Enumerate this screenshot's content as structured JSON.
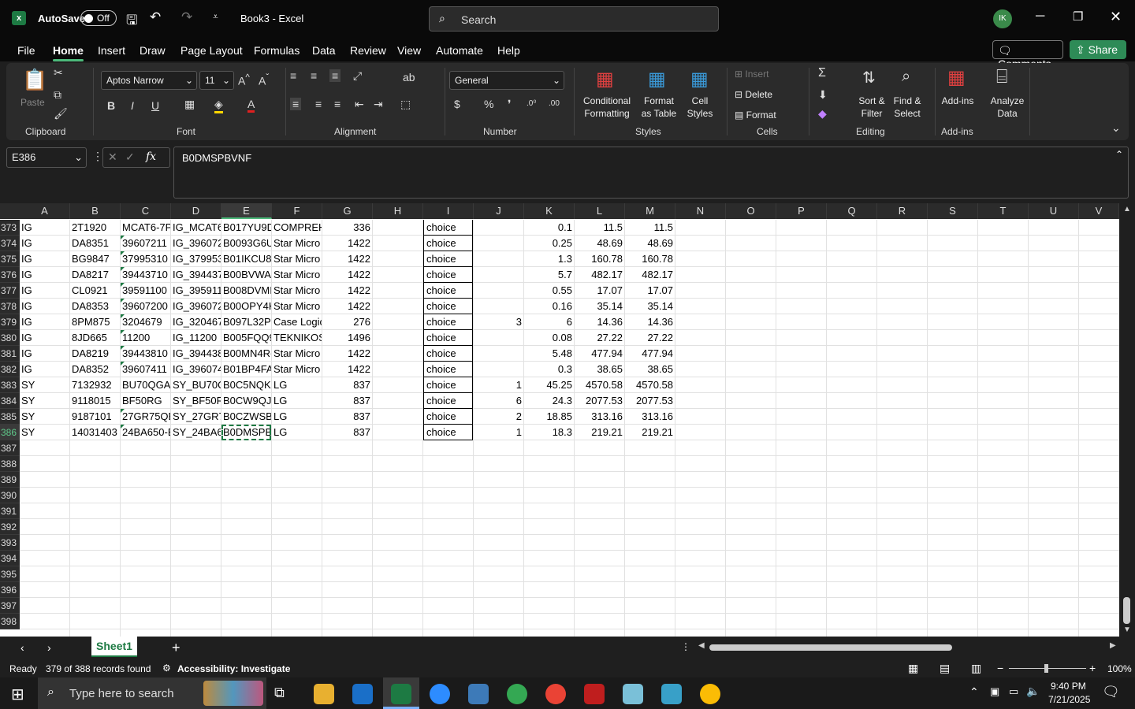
{
  "title_bar": {
    "autosave_label": "AutoSave",
    "autosave_state": "Off",
    "doc_title": "Book3 - Excel",
    "search_placeholder": "Search",
    "avatar_initials": "IK"
  },
  "menu": {
    "items": [
      "File",
      "Home",
      "Insert",
      "Draw",
      "Page Layout",
      "Formulas",
      "Data",
      "Review",
      "View",
      "Automate",
      "Help"
    ],
    "comments": "Comments",
    "share": "Share"
  },
  "ribbon": {
    "clipboard": {
      "paste": "Paste",
      "label": "Clipboard"
    },
    "font": {
      "name": "Aptos Narrow",
      "size": "11",
      "label": "Font"
    },
    "alignment": {
      "label": "Alignment"
    },
    "number": {
      "format": "General",
      "label": "Number"
    },
    "styles": {
      "conditional": "Conditional Formatting",
      "format_table": "Format as Table",
      "cell_styles": "Cell Styles",
      "label": "Styles"
    },
    "cells": {
      "insert": "Insert",
      "delete": "Delete",
      "format": "Format",
      "label": "Cells"
    },
    "editing": {
      "sort": "Sort & Filter",
      "find": "Find & Select",
      "label": "Editing"
    },
    "addins": {
      "addins": "Add-ins",
      "analyze": "Analyze Data",
      "label": "Add-ins"
    }
  },
  "formula_bar": {
    "name_box": "E386",
    "fx": "fx",
    "value": "B0DMSPBVNF"
  },
  "columns": [
    "A",
    "B",
    "C",
    "D",
    "E",
    "F",
    "G",
    "H",
    "I",
    "J",
    "K",
    "L",
    "M",
    "N",
    "O",
    "P",
    "Q",
    "R",
    "S",
    "T",
    "U",
    "V"
  ],
  "rows": [
    {
      "n": "373",
      "A": "IG",
      "B": "2T1920",
      "C": "MCAT6-7P",
      "D": "IG_MCAT6",
      "E": "B017YU9D",
      "F": "COMPREH",
      "G": "336",
      "I": "choice",
      "J": "",
      "K": "0.1",
      "L": "11.5",
      "M": "11.5"
    },
    {
      "n": "374",
      "A": "IG",
      "B": "DA8351",
      "C": "39607211",
      "D": "IG_396072",
      "E": "B0093G6U",
      "F": "Star Micro",
      "G": "1422",
      "I": "choice",
      "J": "",
      "K": "0.25",
      "L": "48.69",
      "M": "48.69"
    },
    {
      "n": "375",
      "A": "IG",
      "B": "BG9847",
      "C": "37995310",
      "D": "IG_379953",
      "E": "B01IKCU8/",
      "F": "Star Micro",
      "G": "1422",
      "I": "choice",
      "J": "",
      "K": "1.3",
      "L": "160.78",
      "M": "160.78"
    },
    {
      "n": "376",
      "A": "IG",
      "B": "DA8217",
      "C": "39443710",
      "D": "IG_394437",
      "E": "B00BVWA(",
      "F": "Star Micro",
      "G": "1422",
      "I": "choice",
      "J": "",
      "K": "5.7",
      "L": "482.17",
      "M": "482.17"
    },
    {
      "n": "377",
      "A": "IG",
      "B": "CL0921",
      "C": "39591100",
      "D": "IG_395911",
      "E": "B008DVMI",
      "F": "Star Micro",
      "G": "1422",
      "I": "choice",
      "J": "",
      "K": "0.55",
      "L": "17.07",
      "M": "17.07"
    },
    {
      "n": "378",
      "A": "IG",
      "B": "DA8353",
      "C": "39607200",
      "D": "IG_396072",
      "E": "B00OPY4K",
      "F": "Star Micro",
      "G": "1422",
      "I": "choice",
      "J": "",
      "K": "0.16",
      "L": "35.14",
      "M": "35.14"
    },
    {
      "n": "379",
      "A": "IG",
      "B": "8PM875",
      "C": "3204679",
      "D": "IG_320467",
      "E": "B097L32PI",
      "F": "Case Logic",
      "G": "276",
      "I": "choice",
      "J": "3",
      "K": "6",
      "L": "14.36",
      "M": "14.36"
    },
    {
      "n": "380",
      "A": "IG",
      "B": "8JD665",
      "C": "11200",
      "D": "IG_11200",
      "E": "B005FQQ9",
      "F": "TEKNIKOS",
      "G": "1496",
      "I": "choice",
      "J": "",
      "K": "0.08",
      "L": "27.22",
      "M": "27.22"
    },
    {
      "n": "381",
      "A": "IG",
      "B": "DA8219",
      "C": "39443810",
      "D": "IG_394438",
      "E": "B00MN4R(",
      "F": "Star Micro",
      "G": "1422",
      "I": "choice",
      "J": "",
      "K": "5.48",
      "L": "477.94",
      "M": "477.94"
    },
    {
      "n": "382",
      "A": "IG",
      "B": "DA8352",
      "C": "39607411",
      "D": "IG_396074",
      "E": "B01BP4FA",
      "F": "Star Micro",
      "G": "1422",
      "I": "choice",
      "J": "",
      "K": "0.3",
      "L": "38.65",
      "M": "38.65"
    },
    {
      "n": "383",
      "A": "SY",
      "B": "7132932",
      "C": "BU70QGA",
      "D": "SY_BU70Q",
      "E": "B0C5NQKI",
      "F": "LG",
      "G": "837",
      "I": "choice",
      "J": "1",
      "K": "45.25",
      "L": "4570.58",
      "M": "4570.58"
    },
    {
      "n": "384",
      "A": "SY",
      "B": "9118015",
      "C": "BF50RG",
      "D": "SY_BF50R(",
      "E": "B0CW9QJ6",
      "F": "LG",
      "G": "837",
      "I": "choice",
      "J": "6",
      "K": "24.3",
      "L": "2077.53",
      "M": "2077.53"
    },
    {
      "n": "385",
      "A": "SY",
      "B": "9187101",
      "C": "27GR75QE",
      "D": "SY_27GR7!",
      "E": "B0CZWSB1",
      "F": "LG",
      "G": "837",
      "I": "choice",
      "J": "2",
      "K": "18.85",
      "L": "313.16",
      "M": "313.16"
    },
    {
      "n": "386",
      "A": "SY",
      "B": "14031403",
      "C": "24BA650-E",
      "D": "SY_24BA65",
      "E": "B0DMSPB\\",
      "F": "LG",
      "G": "837",
      "I": "choice",
      "J": "1",
      "K": "18.3",
      "L": "219.21",
      "M": "219.21"
    },
    {
      "n": "387"
    },
    {
      "n": "388"
    },
    {
      "n": "389"
    },
    {
      "n": "390"
    },
    {
      "n": "391"
    },
    {
      "n": "392"
    },
    {
      "n": "393"
    },
    {
      "n": "394"
    },
    {
      "n": "395"
    },
    {
      "n": "396"
    },
    {
      "n": "397"
    },
    {
      "n": "398"
    }
  ],
  "sheet_tab": "Sheet1",
  "status": {
    "ready": "Ready",
    "records": "379 of 388 records found",
    "accessibility": "Accessibility: Investigate",
    "zoom": "100%"
  },
  "taskbar": {
    "search_placeholder": "Type here to search",
    "time": "9:40 PM",
    "date": "7/21/2025"
  }
}
